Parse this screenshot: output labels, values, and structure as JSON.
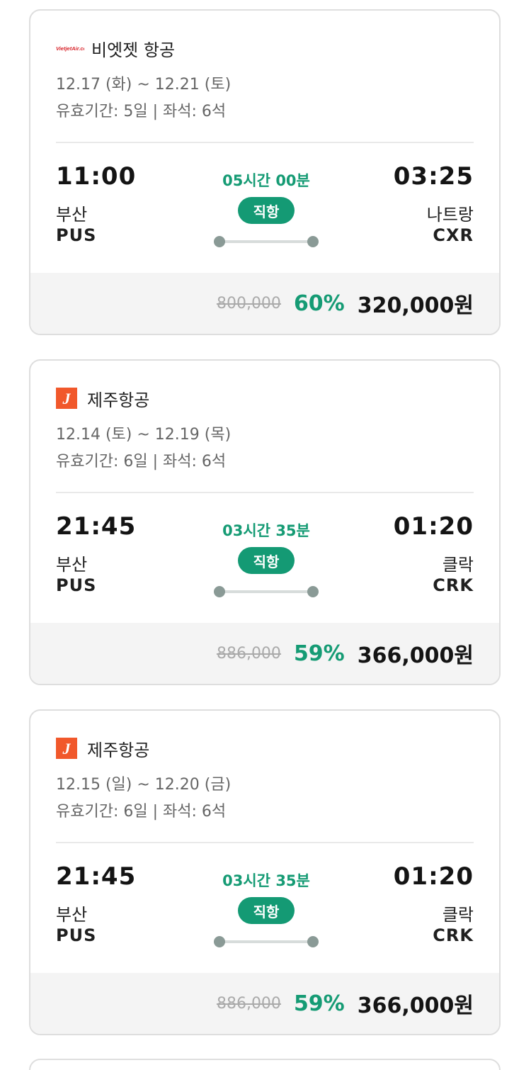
{
  "flights": [
    {
      "airline": {
        "name": "비엣젯 항공",
        "logo": "vietjet-logo",
        "logo_text": "VietjetAir.com"
      },
      "dates": "12.17 (화) ~ 12.21 (토)",
      "validity": "유효기간: 5일 | 좌석: 6석",
      "departure": {
        "time": "11:00",
        "city": "부산",
        "code": "PUS"
      },
      "arrival": {
        "time": "03:25",
        "city": "나트랑",
        "code": "CXR"
      },
      "duration": "05시간 00분",
      "type": "직항",
      "original_price": "800,000",
      "discount": "60%",
      "price": "320,000원"
    },
    {
      "airline": {
        "name": "제주항공",
        "logo": "jejuair-logo",
        "logo_text": "J"
      },
      "dates": "12.14 (토) ~ 12.19 (목)",
      "validity": "유효기간: 6일 | 좌석: 6석",
      "departure": {
        "time": "21:45",
        "city": "부산",
        "code": "PUS"
      },
      "arrival": {
        "time": "01:20",
        "city": "클락",
        "code": "CRK"
      },
      "duration": "03시간 35분",
      "type": "직항",
      "original_price": "886,000",
      "discount": "59%",
      "price": "366,000원"
    },
    {
      "airline": {
        "name": "제주항공",
        "logo": "jejuair-logo",
        "logo_text": "J"
      },
      "dates": "12.15 (일) ~ 12.20 (금)",
      "validity": "유효기간: 6일 | 좌석: 6석",
      "departure": {
        "time": "21:45",
        "city": "부산",
        "code": "PUS"
      },
      "arrival": {
        "time": "01:20",
        "city": "클락",
        "code": "CRK"
      },
      "duration": "03시간 35분",
      "type": "직항",
      "original_price": "886,000",
      "discount": "59%",
      "price": "366,000원"
    }
  ],
  "colors": {
    "accent_green": "#149a74",
    "jeju_orange": "#f1582b",
    "vietjet_red": "#d8232a"
  }
}
